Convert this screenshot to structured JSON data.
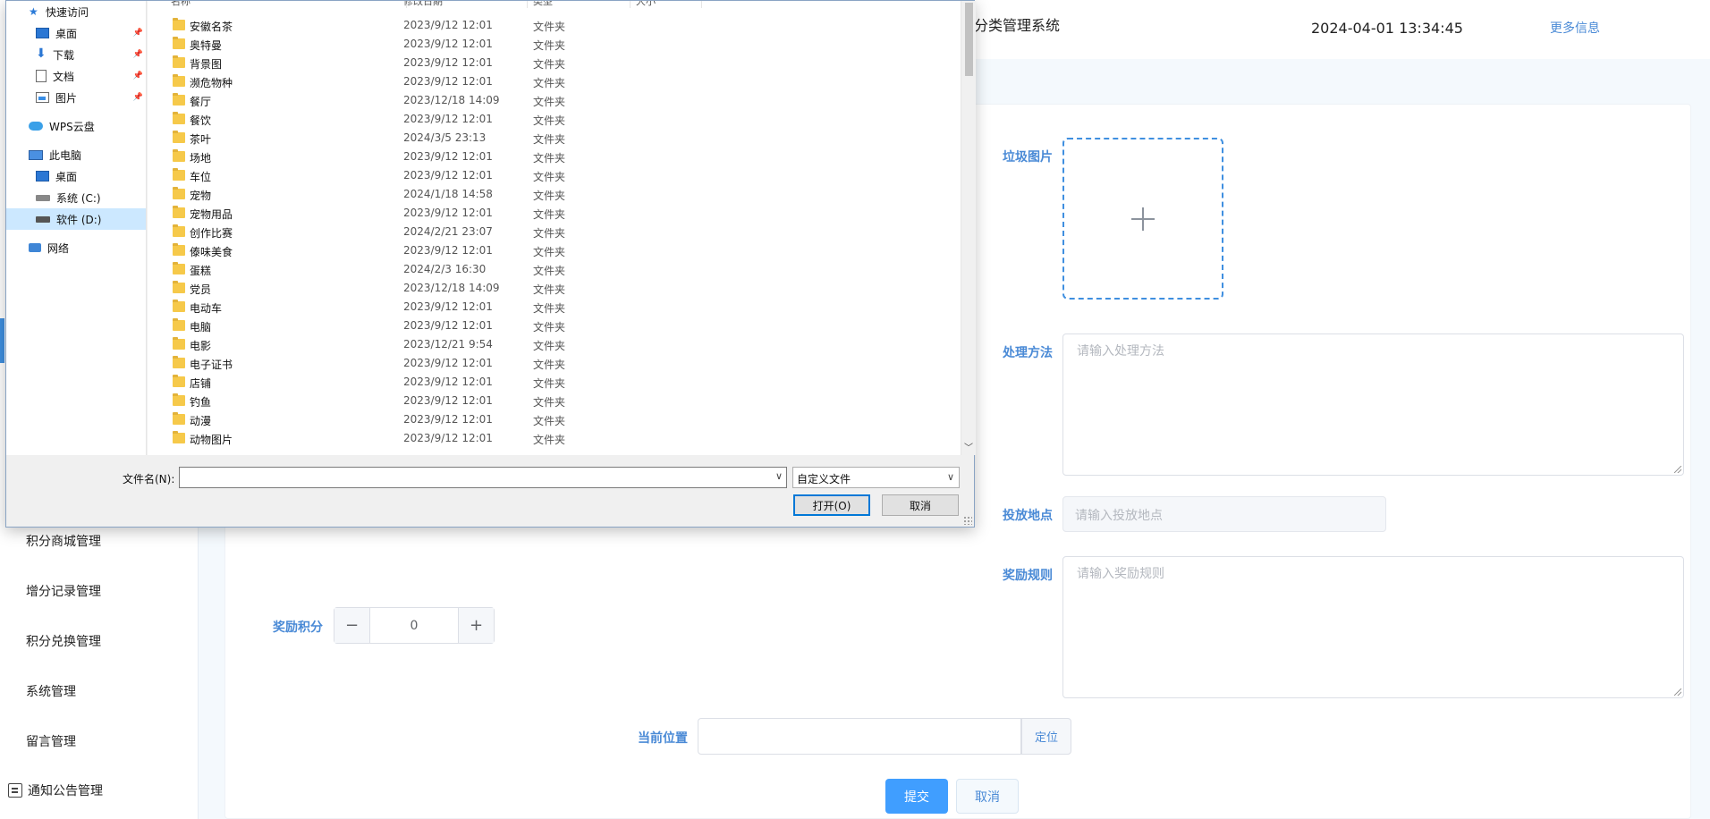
{
  "app": {
    "title": "分类管理系统",
    "datetime": "2024-04-01 13:34:45",
    "more": "更多信息"
  },
  "sidebar": {
    "items": [
      "积分商城管理",
      "增分记录管理",
      "积分兑换管理",
      "系统管理",
      "留言管理",
      "通知公告管理"
    ]
  },
  "form": {
    "image_label": "垃圾图片",
    "method_label": "处理方法",
    "method_placeholder": "请输入处理方法",
    "place_label": "投放地点",
    "place_placeholder": "请输入投放地点",
    "rule_label": "奖励规则",
    "rule_placeholder": "请输入奖励规则",
    "points_label": "奖励积分",
    "points_value": "0",
    "points_minus": "−",
    "points_plus": "+",
    "location_label": "当前位置",
    "locate_button": "定位",
    "submit_button": "提交",
    "cancel_button": "取消"
  },
  "dialog": {
    "nav": [
      {
        "label": "快速访问",
        "icon": "star-icon"
      },
      {
        "label": "桌面",
        "icon": "desktop-icon",
        "pinned": true
      },
      {
        "label": "下载",
        "icon": "download-icon",
        "pinned": true
      },
      {
        "label": "文档",
        "icon": "document-icon",
        "pinned": true
      },
      {
        "label": "图片",
        "icon": "picture-icon",
        "pinned": true
      },
      {
        "label": "WPS云盘",
        "icon": "cloud-icon"
      },
      {
        "label": "此电脑",
        "icon": "computer-icon"
      },
      {
        "label": "桌面",
        "icon": "desktop-icon"
      },
      {
        "label": "系统 (C:)",
        "icon": "drive-icon"
      },
      {
        "label": "软件 (D:)",
        "icon": "drive-icon",
        "selected": true
      },
      {
        "label": "网络",
        "icon": "network-icon"
      }
    ],
    "columns": [
      "名称",
      "修改日期",
      "类型",
      "大小"
    ],
    "files": [
      {
        "name": "安徽名茶",
        "date": "2023/9/12 12:01",
        "type": "文件夹"
      },
      {
        "name": "奥特曼",
        "date": "2023/9/12 12:01",
        "type": "文件夹"
      },
      {
        "name": "背景图",
        "date": "2023/9/12 12:01",
        "type": "文件夹"
      },
      {
        "name": "濒危物种",
        "date": "2023/9/12 12:01",
        "type": "文件夹"
      },
      {
        "name": "餐厅",
        "date": "2023/12/18 14:09",
        "type": "文件夹"
      },
      {
        "name": "餐饮",
        "date": "2023/9/12 12:01",
        "type": "文件夹"
      },
      {
        "name": "茶叶",
        "date": "2024/3/5 23:13",
        "type": "文件夹"
      },
      {
        "name": "场地",
        "date": "2023/9/12 12:01",
        "type": "文件夹"
      },
      {
        "name": "车位",
        "date": "2023/9/12 12:01",
        "type": "文件夹"
      },
      {
        "name": "宠物",
        "date": "2024/1/18 14:58",
        "type": "文件夹"
      },
      {
        "name": "宠物用品",
        "date": "2023/9/12 12:01",
        "type": "文件夹"
      },
      {
        "name": "创作比赛",
        "date": "2024/2/21 23:07",
        "type": "文件夹"
      },
      {
        "name": "傣味美食",
        "date": "2023/9/12 12:01",
        "type": "文件夹"
      },
      {
        "name": "蛋糕",
        "date": "2024/2/3 16:30",
        "type": "文件夹"
      },
      {
        "name": "党员",
        "date": "2023/12/18 14:09",
        "type": "文件夹"
      },
      {
        "name": "电动车",
        "date": "2023/9/12 12:01",
        "type": "文件夹"
      },
      {
        "name": "电脑",
        "date": "2023/9/12 12:01",
        "type": "文件夹"
      },
      {
        "name": "电影",
        "date": "2023/12/21 9:54",
        "type": "文件夹"
      },
      {
        "name": "电子证书",
        "date": "2023/9/12 12:01",
        "type": "文件夹"
      },
      {
        "name": "店铺",
        "date": "2023/9/12 12:01",
        "type": "文件夹"
      },
      {
        "name": "钓鱼",
        "date": "2023/9/12 12:01",
        "type": "文件夹"
      },
      {
        "name": "动漫",
        "date": "2023/9/12 12:01",
        "type": "文件夹"
      },
      {
        "name": "动物图片",
        "date": "2023/9/12 12:01",
        "type": "文件夹"
      }
    ],
    "filename_label": "文件名(N):",
    "filename_value": "",
    "filetype": "自定义文件",
    "open_button": "打开(O)",
    "cancel_button": "取消"
  }
}
